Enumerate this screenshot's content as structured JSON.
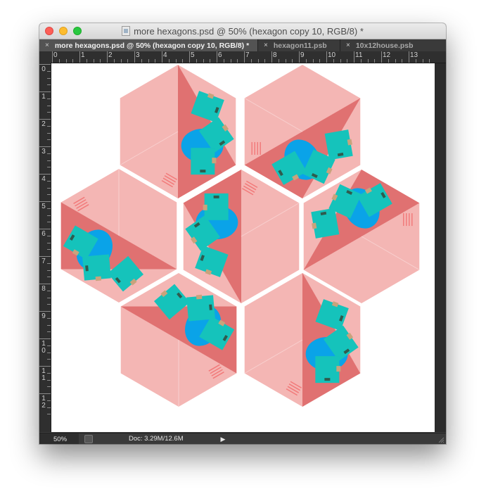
{
  "window": {
    "title": "more hexagons.psd @ 50% (hexagon copy 10, RGB/8) *"
  },
  "tabs": [
    {
      "label": "more hexagons.psd @ 50% (hexagon copy 10, RGB/8) *",
      "active": true
    },
    {
      "label": "hexagon11.psb",
      "active": false
    },
    {
      "label": "10x12house.psb",
      "active": false
    }
  ],
  "tab_close_glyph": "×",
  "rulers": {
    "horizontal": [
      "0",
      "1",
      "2",
      "3",
      "4",
      "5",
      "6",
      "7",
      "8",
      "9",
      "10",
      "11",
      "12",
      "13"
    ],
    "vertical": [
      "0",
      "1",
      "2",
      "3",
      "4",
      "5",
      "6",
      "7",
      "8",
      "9",
      "10",
      "11",
      "12"
    ]
  },
  "status": {
    "zoom": "50%",
    "doc_label": "Doc: 3.29M/12.6M",
    "arrow": "▶"
  },
  "colors": {
    "light_pink": "#f4b6b4",
    "coral": "#e07171",
    "teal": "#15c3bb",
    "blue": "#0aa3e8",
    "chair": "#c8a37c",
    "stripe": "#f27a7a"
  }
}
